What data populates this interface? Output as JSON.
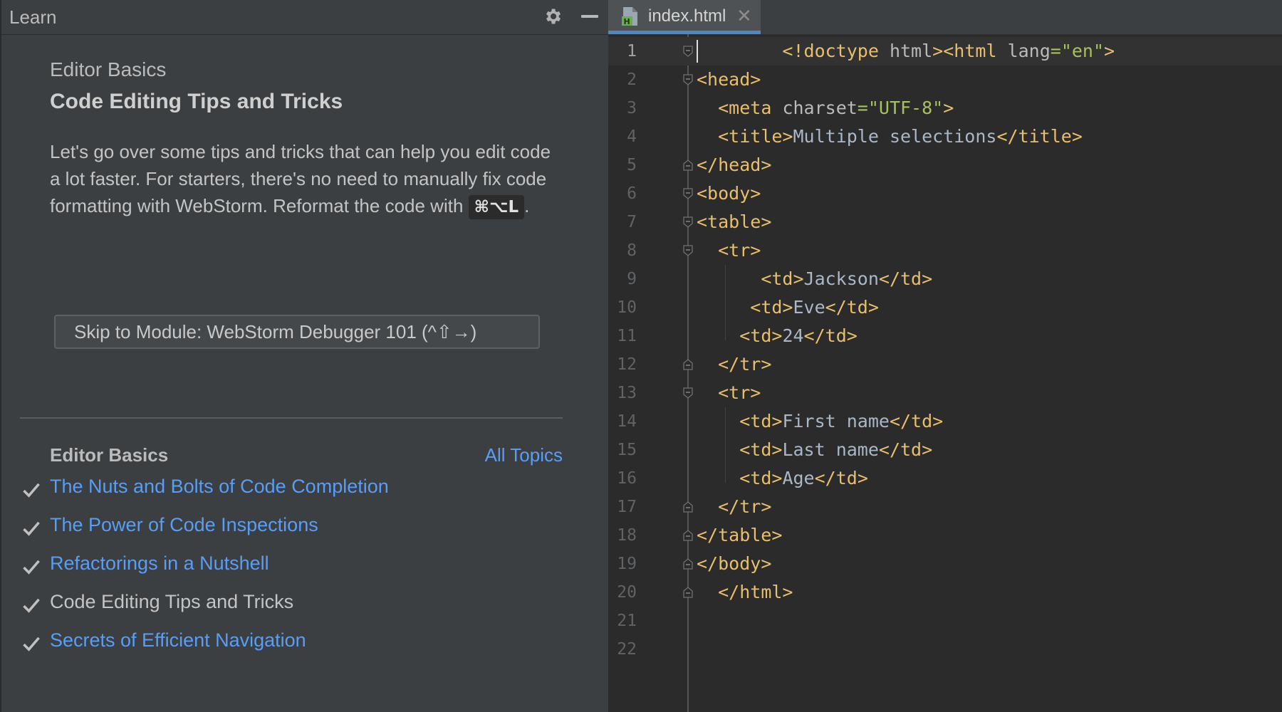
{
  "learn_panel": {
    "title": "Learn",
    "lesson_module": "Editor Basics",
    "lesson_title": "Code Editing Tips and Tricks",
    "description_text": "Let's go over some tips and tricks that can help you edit code a lot faster. For starters, there's no need to manually fix code formatting with WebStorm. Reformat the code with",
    "shortcut": "⌘⌥L",
    "description_end": ".",
    "skip_button": "Skip to Module: WebStorm Debugger 101 (^⇧→)",
    "toc_heading": "Editor Basics",
    "all_topics": "All Topics",
    "toc_items": [
      {
        "label": "The Nuts and Bolts of Code Completion",
        "state": "done-link"
      },
      {
        "label": "The Power of Code Inspections",
        "state": "done-link"
      },
      {
        "label": "Refactorings in a Nutshell",
        "state": "done-link"
      },
      {
        "label": "Code Editing Tips and Tricks",
        "state": "current"
      },
      {
        "label": "Secrets of Efficient Navigation",
        "state": "done-link"
      }
    ]
  },
  "editor": {
    "tab_label": "index.html",
    "tab_close": "✕",
    "icons": [
      "gear-icon",
      "minimize-icon",
      "html-file-icon",
      "check-icon",
      "fold-marker-icon"
    ],
    "colors": {
      "link": "#589df6",
      "tag": "#e8bf6a",
      "string": "#a5c25c",
      "text": "#a9b7c6",
      "tab_underline": "#4a88c7"
    },
    "lines": [
      {
        "n": "1",
        "code": "        <!doctype html><html lang=\"en\">"
      },
      {
        "n": "2",
        "code": "<head>"
      },
      {
        "n": "3",
        "code": "  <meta charset=\"UTF-8\">"
      },
      {
        "n": "4",
        "code": "  <title>Multiple selections</title>"
      },
      {
        "n": "5",
        "code": "</head>"
      },
      {
        "n": "6",
        "code": "<body>"
      },
      {
        "n": "7",
        "code": "<table>"
      },
      {
        "n": "8",
        "code": "  <tr>"
      },
      {
        "n": "9",
        "code": "      <td>Jackson</td>"
      },
      {
        "n": "10",
        "code": "     <td>Eve</td>"
      },
      {
        "n": "11",
        "code": "    <td>24</td>"
      },
      {
        "n": "12",
        "code": "  </tr>"
      },
      {
        "n": "13",
        "code": "  <tr>"
      },
      {
        "n": "14",
        "code": "    <td>First name</td>"
      },
      {
        "n": "15",
        "code": "    <td>Last name</td>"
      },
      {
        "n": "16",
        "code": "    <td>Age</td>"
      },
      {
        "n": "17",
        "code": "  </tr>"
      },
      {
        "n": "18",
        "code": "</table>"
      },
      {
        "n": "19",
        "code": "</body>"
      },
      {
        "n": "20",
        "code": "  </html>"
      },
      {
        "n": "21",
        "code": ""
      },
      {
        "n": "22",
        "code": ""
      }
    ]
  }
}
